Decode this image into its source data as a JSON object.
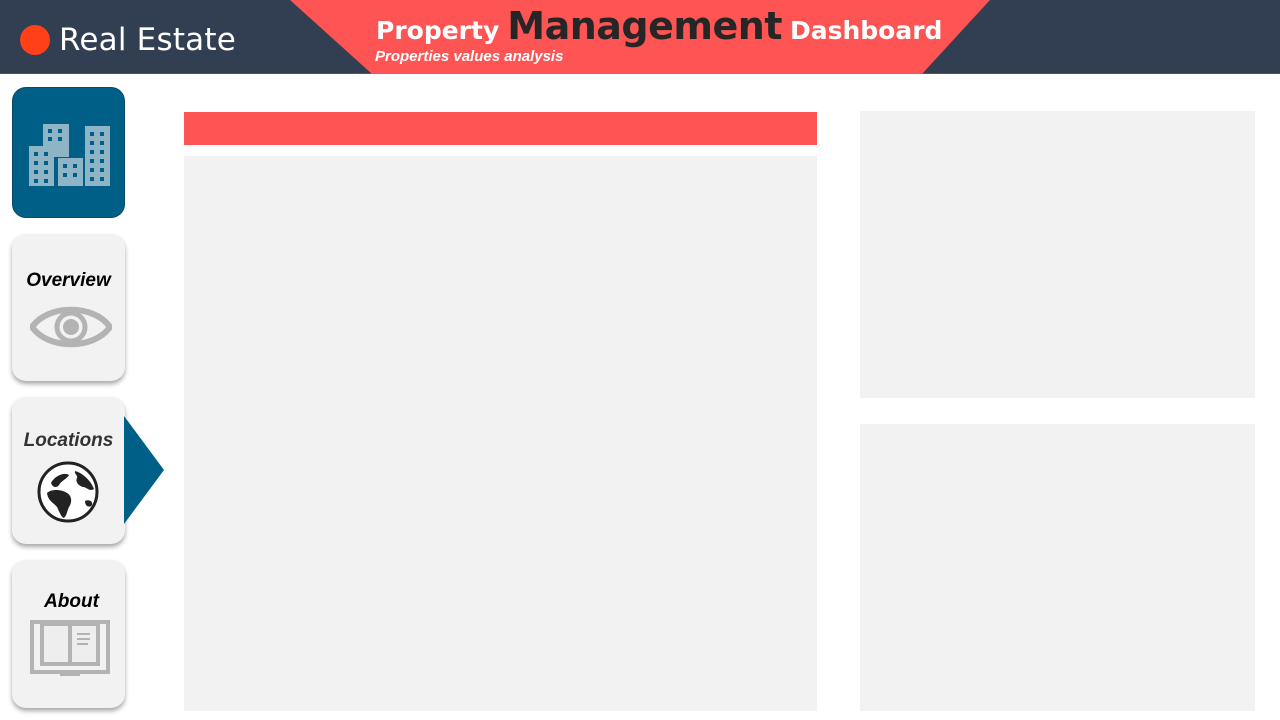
{
  "header": {
    "brand_label": "Real Estate",
    "title_prefix": "Property",
    "title_main": "Management",
    "title_suffix": "Dashboard",
    "subtitle": "Properties values analysis"
  },
  "sidebar": {
    "logo_icon": "city-buildings-icon",
    "items": [
      {
        "label": "Overview",
        "icon": "eye-icon",
        "active": false
      },
      {
        "label": "Locations",
        "icon": "globe-icon",
        "active": true
      },
      {
        "label": "About",
        "icon": "open-book-icon",
        "active": false
      }
    ]
  },
  "colors": {
    "header_bg": "#323e52",
    "accent_red": "#ff5454",
    "brand_dot": "#ff4019",
    "logo_tile": "#005f86",
    "panel_bg": "#f2f2f2",
    "icon_gray": "#b3b3b3",
    "title_dark": "#262626"
  }
}
